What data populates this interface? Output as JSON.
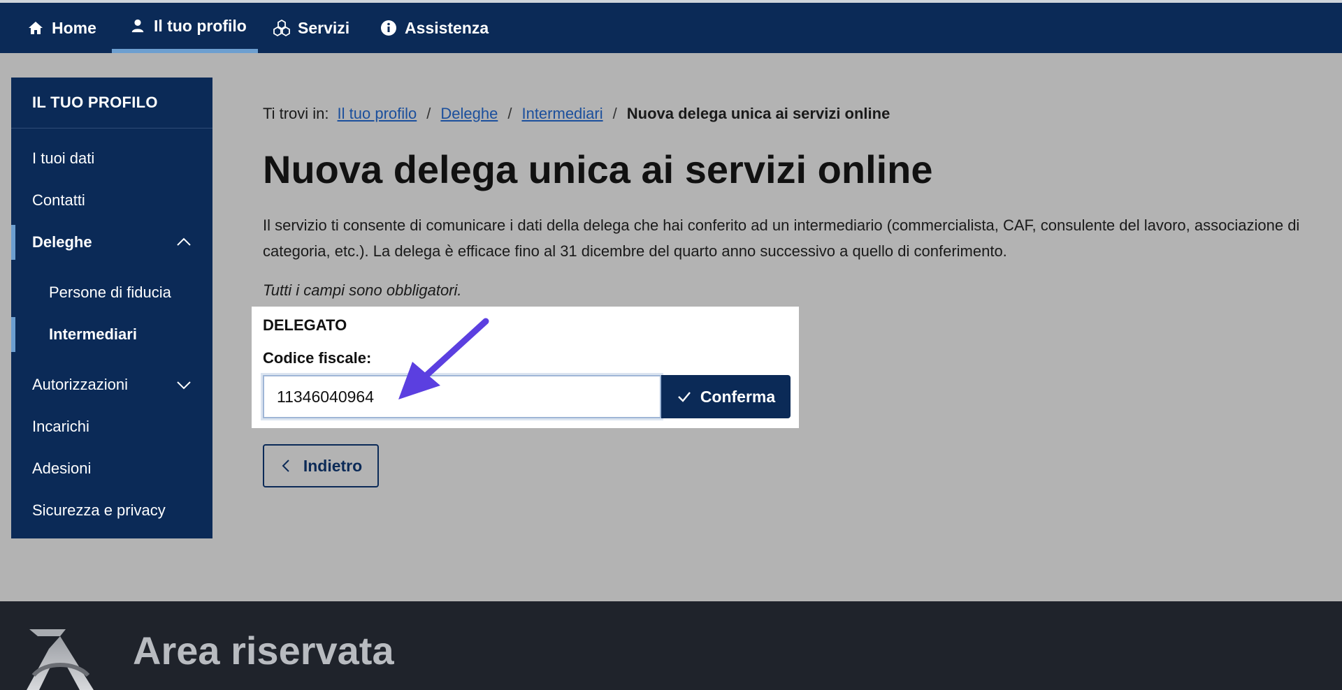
{
  "nav": {
    "items": [
      {
        "label": "Home",
        "icon": "home-icon"
      },
      {
        "label": "Il tuo profilo",
        "icon": "user-icon",
        "active": true
      },
      {
        "label": "Servizi",
        "icon": "cubes-icon"
      },
      {
        "label": "Assistenza",
        "icon": "info-icon"
      }
    ]
  },
  "sidebar": {
    "title": "IL TUO PROFILO",
    "items": [
      {
        "label": "I tuoi dati"
      },
      {
        "label": "Contatti"
      },
      {
        "label": "Deleghe",
        "expanded": true
      },
      {
        "label": "Persone di fiducia"
      },
      {
        "label": "Intermediari",
        "active": true
      },
      {
        "label": "Autorizzazioni",
        "expanded": false
      },
      {
        "label": "Incarichi"
      },
      {
        "label": "Adesioni"
      },
      {
        "label": "Sicurezza e privacy"
      }
    ]
  },
  "breadcrumb": {
    "prefix": "Ti trovi in:",
    "links": [
      "Il tuo profilo",
      "Deleghe",
      "Intermediari"
    ],
    "separator": "/",
    "current": "Nuova delega unica ai servizi online"
  },
  "page": {
    "title": "Nuova delega unica ai servizi online",
    "description": "Il servizio ti consente di comunicare i dati della delega che hai conferito ad un intermediario (commercialista, CAF, consulente del lavoro, associazione di categoria, etc.). La delega è efficace fino al 31 dicembre del quarto anno successivo a quello di conferimento.",
    "required_note": "Tutti i campi sono obbligatori."
  },
  "form": {
    "section_title": "DELEGATO",
    "field_label": "Codice fiscale:",
    "field_value": "11346040964",
    "confirm_label": "Conferma"
  },
  "back_label": "Indietro",
  "footer": {
    "title": "Area riservata"
  },
  "colors": {
    "primary": "#0b2a57",
    "link": "#1b4f9c",
    "accent": "#6d9fd0",
    "annotation_arrow": "#5b3fe0"
  }
}
